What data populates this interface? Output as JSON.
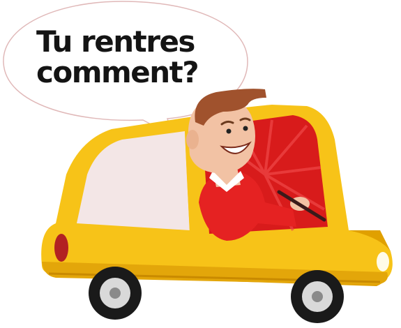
{
  "speech_bubble": {
    "line1": "Tu rentres",
    "line2": "comment?"
  },
  "colors": {
    "car_body": "#f7c318",
    "car_shadow": "#e0a000",
    "window_bg": "#d81b1b",
    "shirt": "#e52222",
    "skin": "#f2c2a4",
    "hair": "#a0522d",
    "tire": "#1a1a1a",
    "hubcap": "#d9d9d9",
    "taillight": "#b22222",
    "headlight": "#fffbe8",
    "bubble_fill": "#ffffff",
    "bubble_stroke": "#e0b8b8"
  },
  "icons": {
    "car": "car-illustration",
    "driver": "driver-illustration",
    "bubble": "speech-bubble"
  }
}
